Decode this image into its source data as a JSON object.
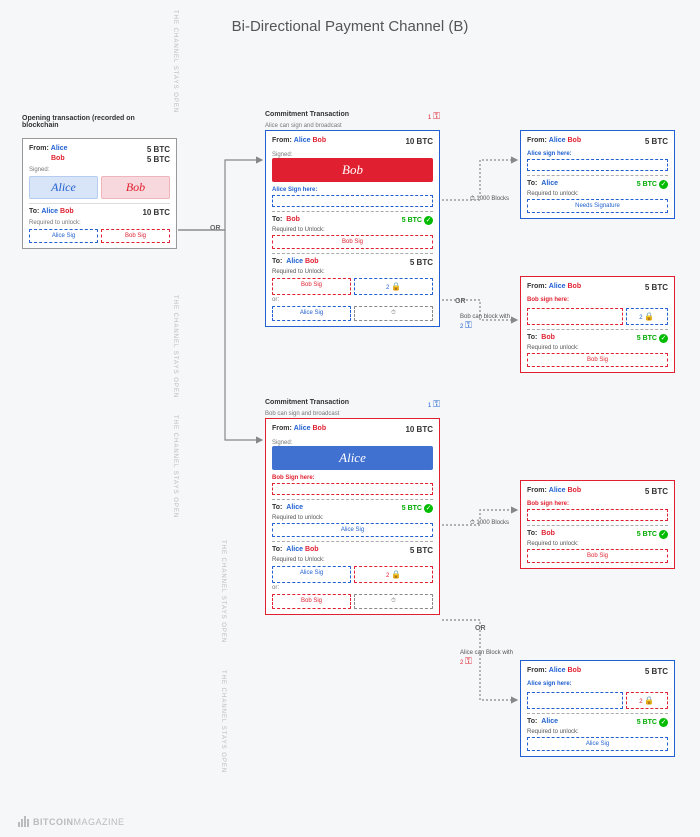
{
  "title": "Bi-Directional Payment Channel (B)",
  "sideText": "THE CHANNEL STAYS OPEN",
  "logo": {
    "brand": "BITCOIN",
    "suffix": "MAGAZINE"
  },
  "opening": {
    "header": "Opening transaction (recorded on blockchain",
    "fromLabel": "From:",
    "alice": "Alice",
    "bob": "Bob",
    "amt1": "5 BTC",
    "amt2": "5 BTC",
    "signedLabel": "Signed:",
    "toLabel": "To:",
    "totalAmt": "10 BTC",
    "reqLabel": "Required to unlock:",
    "aliceSig": "Alice Sig",
    "bobSig": "Bob Sig"
  },
  "commitA": {
    "header": "Commitment Transaction",
    "sub": "Alice can sign and broadcast",
    "keyNum": "1",
    "fromLabel": "From:",
    "alice": "Alice",
    "bob": "Bob",
    "total": "10 BTC",
    "signedLabel": "Signed:",
    "signed": "Bob",
    "signHere": "Alice Sign here:",
    "out1": {
      "toLabel": "To:",
      "to": "Bob",
      "amt": "5 BTC",
      "reqLabel": "Required to Unlock:",
      "sig": "Bob Sig"
    },
    "out2": {
      "toLabel": "To:",
      "to1": "Alice",
      "to2": "Bob",
      "amt": "5 BTC",
      "reqLabel": "Required to Unlock:",
      "sig1": "Bob Sig",
      "num": "2",
      "orLabel": "or:",
      "sig2": "Alice Sig"
    }
  },
  "commitB": {
    "header": "Commitment Transaction",
    "sub": "Bob can sign and broadcast",
    "keyNum": "1",
    "fromLabel": "From:",
    "alice": "Alice",
    "bob": "Bob",
    "total": "10 BTC",
    "signedLabel": "Signed:",
    "signed": "Alice",
    "signHere": "Bob Sign here:",
    "out1": {
      "toLabel": "To:",
      "to": "Alice",
      "amt": "5 BTC",
      "reqLabel": "Required to unlock:",
      "sig": "Alice Sig"
    },
    "out2": {
      "toLabel": "To:",
      "to1": "Alice",
      "to2": "Bob",
      "amt": "5 BTC",
      "reqLabel": "Required to Unlock:",
      "sig1": "Alice Sig",
      "num": "2",
      "orLabel": "or:",
      "sig2": "Bob Sig"
    }
  },
  "flow": {
    "blocks": "1000 Blocks",
    "bobBlock": "Bob can block with",
    "aliceBlock": "Alice can Block with",
    "num": "2",
    "or": "OR"
  },
  "rA1": {
    "fromLabel": "From:",
    "alice": "Alice",
    "bob": "Bob",
    "amt": "5 BTC",
    "signLabel": "Alice sign here:",
    "toLabel": "To:",
    "to": "Alice",
    "outAmt": "5 BTC",
    "reqLabel": "Required to unlock:",
    "sig": "Needs Signature"
  },
  "rA2": {
    "fromLabel": "From:",
    "alice": "Alice",
    "bob": "Bob",
    "amt": "5 BTC",
    "signLabel": "Bob sign here:",
    "num": "2",
    "toLabel": "To:",
    "to": "Bob",
    "outAmt": "5 BTC",
    "reqLabel": "Required to unlock:",
    "sig": "Bob Sig"
  },
  "rB1": {
    "fromLabel": "From:",
    "alice": "Alice",
    "bob": "Bob",
    "amt": "5 BTC",
    "signLabel": "Bob sign here:",
    "toLabel": "To:",
    "to": "Bob",
    "outAmt": "5 BTC",
    "reqLabel": "Required to unlock:",
    "sig": "Bob Sig"
  },
  "rB2": {
    "fromLabel": "From:",
    "alice": "Alice",
    "bob": "Bob",
    "amt": "5 BTC",
    "signLabel": "Alice sign here:",
    "num": "2",
    "toLabel": "To:",
    "to": "Alice",
    "outAmt": "5 BTC",
    "reqLabel": "Required to unlock:",
    "sig": "Alice Sig"
  }
}
